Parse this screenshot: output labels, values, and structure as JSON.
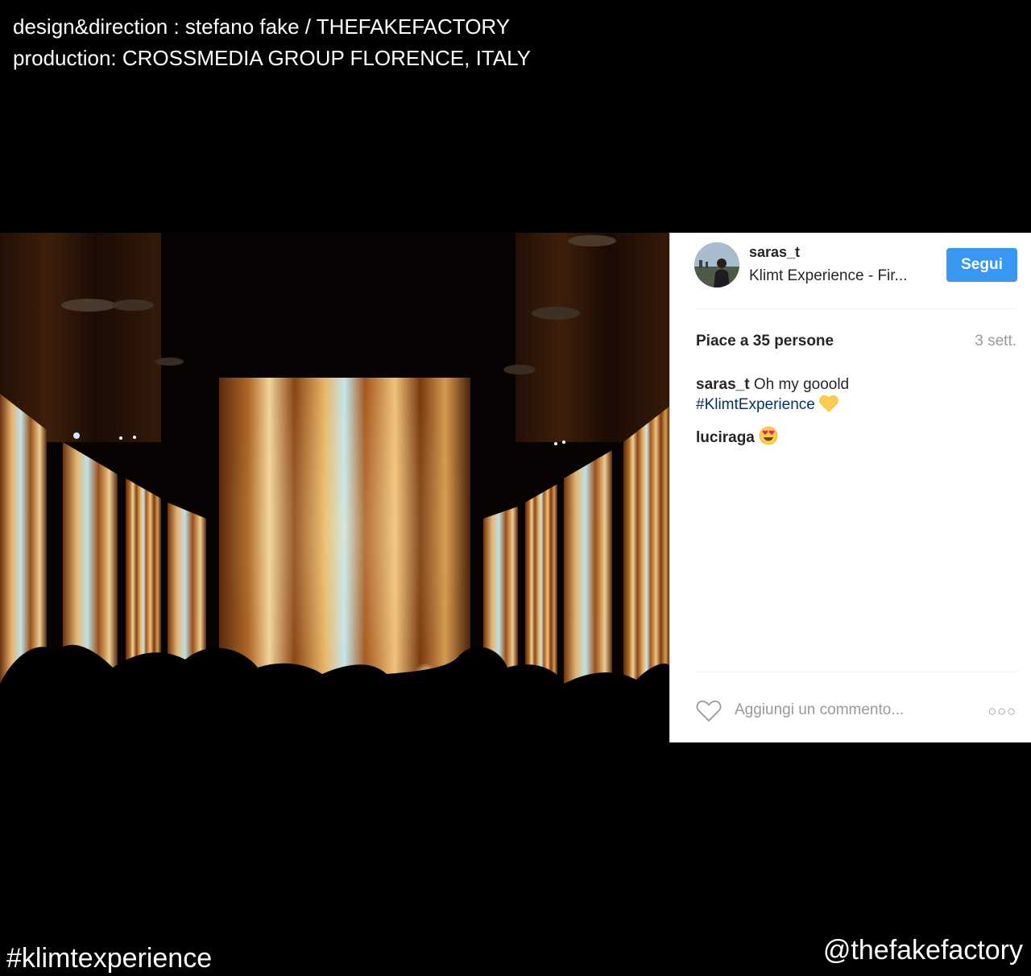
{
  "credits": {
    "line1": "design&direction : stefano fake / THEFAKEFACTORY",
    "line2": "production: CROSSMEDIA GROUP FLORENCE, ITALY"
  },
  "footer": {
    "hashtag": "#klimtexperience",
    "handle": "@thefakefactory"
  },
  "post": {
    "username": "saras_t",
    "location": "Klimt Experience - Fir...",
    "follow_label": "Segui",
    "likes": "Piace a 35 persone",
    "time_ago": "3 sett.",
    "comments": [
      {
        "user": "saras_t",
        "text": " Oh my gooold",
        "hashtag": "#KlimtExperience",
        "emoji": "yellow-heart"
      },
      {
        "user": "luciraga",
        "emoji": "heart-eyes"
      }
    ],
    "add_comment_placeholder": "Aggiungi un commento...",
    "more_label": "○○○",
    "link_color": "#003569",
    "follow_color": "#3897f0"
  }
}
